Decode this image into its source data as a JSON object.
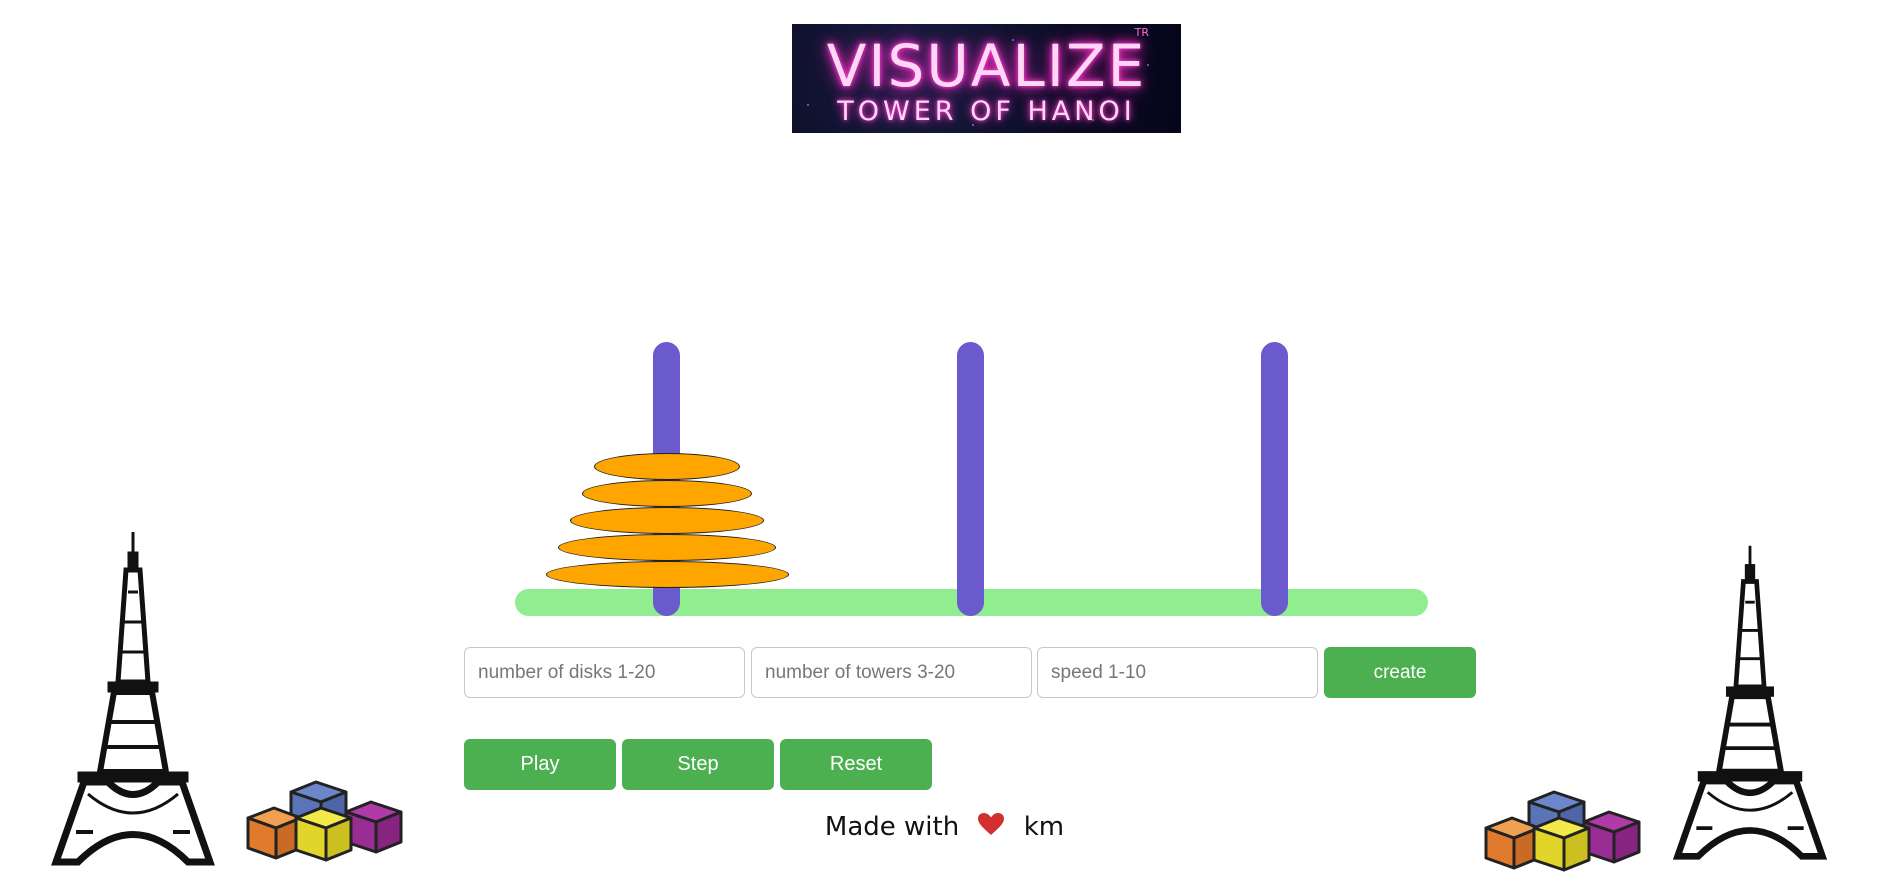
{
  "logo": {
    "title": "VISUALIZE",
    "subtitle": "TOWER OF HANOI",
    "mark": "TR"
  },
  "game": {
    "towers": 3,
    "disks": 5,
    "colors": {
      "base": "#90ee90",
      "peg": "#6a5acd",
      "disk": "#ffa500"
    }
  },
  "controls": {
    "disks_placeholder": "number of disks 1-20",
    "towers_placeholder": "number of towers 3-20",
    "speed_placeholder": "speed 1-10",
    "create_label": "create",
    "play_label": "Play",
    "step_label": "Step",
    "reset_label": "Reset",
    "accent": "#4caf50"
  },
  "footer": {
    "prefix": "Made with",
    "heart_icon": "heart-icon",
    "suffix": "km"
  },
  "decorations": {
    "left_tower_icon": "eiffel-tower-icon",
    "left_blocks_icon": "blocks-icon",
    "right_blocks_icon": "blocks-icon",
    "right_tower_icon": "eiffel-tower-icon"
  }
}
